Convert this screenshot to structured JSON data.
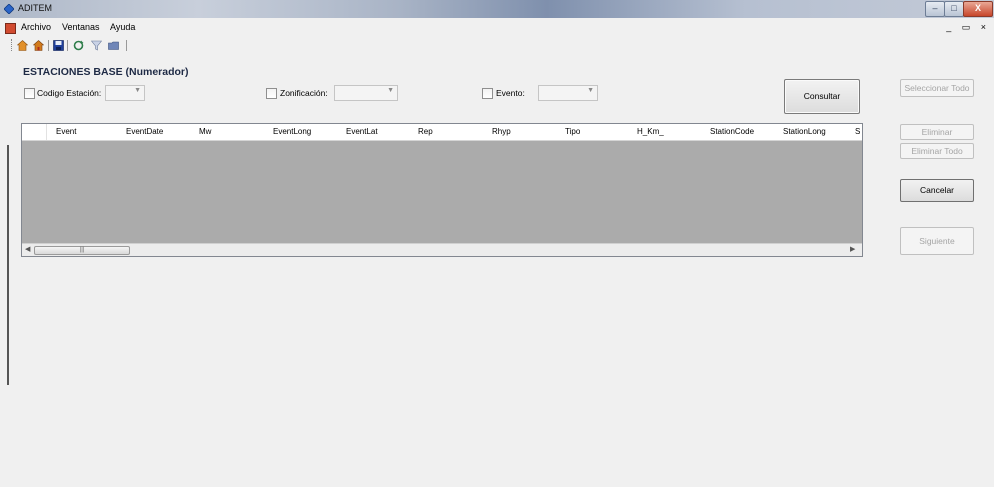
{
  "window": {
    "title": "ADITEM",
    "min": "–",
    "max": "□",
    "close": "X"
  },
  "menu": {
    "items": [
      "Archivo",
      "Ventanas",
      "Ayuda"
    ],
    "mdi_controls": "_ ▭ ×"
  },
  "toolbar": {
    "icons": [
      "home-icon",
      "home-alt-icon",
      "save-icon",
      "refresh-icon",
      "filter-icon",
      "folder-icon"
    ]
  },
  "form": {
    "heading": "ESTACIONES BASE (Numerador)",
    "codigo_label": "Codigo Estación:",
    "zonificacion_label": "Zonificación:",
    "evento_label": "Evento:",
    "consultar": "Consultar"
  },
  "grid": {
    "columns": [
      "Event",
      "EventDate",
      "Mw",
      "EventLong",
      "EventLat",
      "Rep",
      "Rhyp",
      "Tipo",
      "H_Km_",
      "StationCode",
      "StationLong",
      "S"
    ],
    "rows": []
  },
  "side_buttons": {
    "seleccionar_todo": "Seleccionar Todo",
    "eliminar": "Eliminar",
    "eliminar_todo": "Eliminar Todo",
    "cancelar": "Cancelar",
    "siguiente": "Siguiente"
  }
}
